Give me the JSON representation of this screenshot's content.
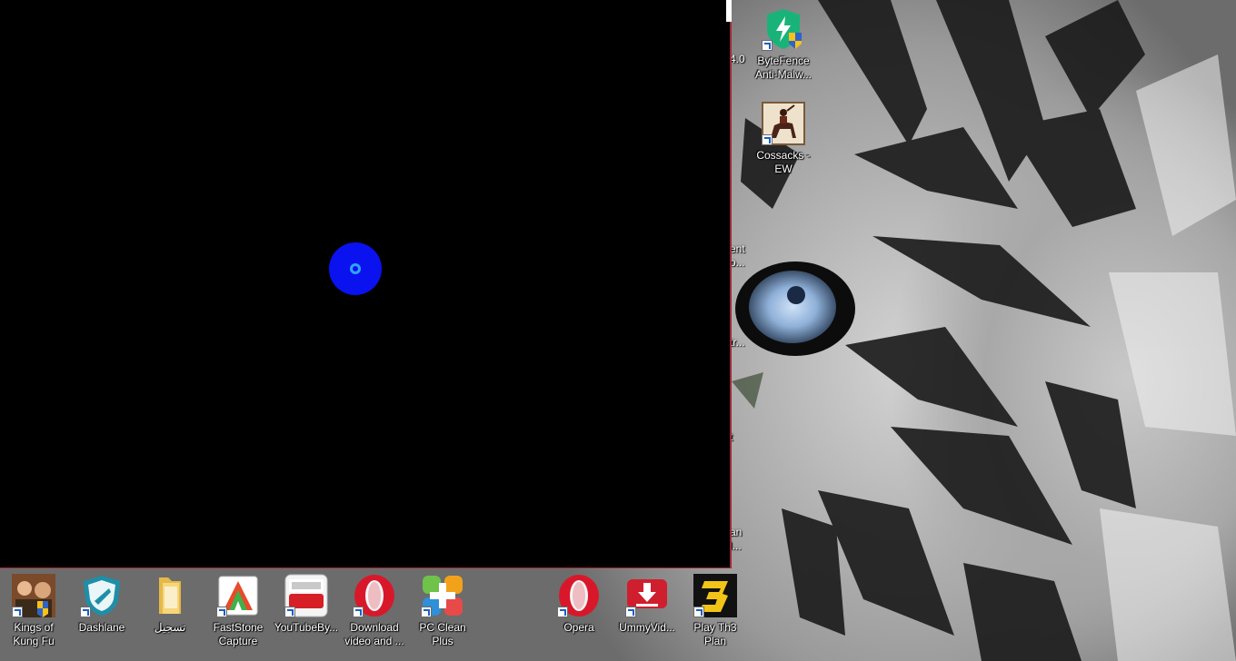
{
  "desktop": {
    "wallpaper": "white tiger close-up, monochrome with blue eye",
    "right_column": [
      {
        "name": "bytefence",
        "label": "ByteFence Anti-Malw...",
        "icon": "shield-lightning-icon"
      },
      {
        "name": "cossacks",
        "label": "Cossacks - EW",
        "icon": "horse-rider-icon"
      }
    ],
    "taskbar_row": [
      {
        "name": "kings-of-kung-fu",
        "label": "Kings of Kung Fu",
        "icon": "game-portrait-icon"
      },
      {
        "name": "dashlane",
        "label": "Dashlane",
        "icon": "dashlane-shield-icon"
      },
      {
        "name": "tasjeel-folder",
        "label": "تسجيل",
        "icon": "folder-icon"
      },
      {
        "name": "faststone-capture",
        "label": "FastStone Capture",
        "icon": "faststone-icon"
      },
      {
        "name": "youtubebyclick",
        "label": "YouTubeBy...",
        "icon": "youtube-byclick-icon"
      },
      {
        "name": "download-video",
        "label": "Download video and ...",
        "icon": "opera-icon"
      },
      {
        "name": "pc-clean-plus",
        "label": "PC Clean Plus",
        "icon": "pc-clean-icon"
      },
      {
        "name": "opera",
        "label": "Opera",
        "icon": "opera-icon"
      },
      {
        "name": "ummyvideo",
        "label": "UmmyVid...",
        "icon": "download-arrow-icon"
      },
      {
        "name": "play-th3-plan",
        "label": "Play Th3 Plan",
        "icon": "number-three-icon"
      }
    ],
    "peek_labels": [
      "4.0",
      "ent",
      "o...",
      "tr...",
      "t",
      "an",
      "l..."
    ]
  },
  "window": {
    "background": "#000000",
    "border_color": "#9b2a36",
    "indicator_color": "#0a12f0"
  }
}
